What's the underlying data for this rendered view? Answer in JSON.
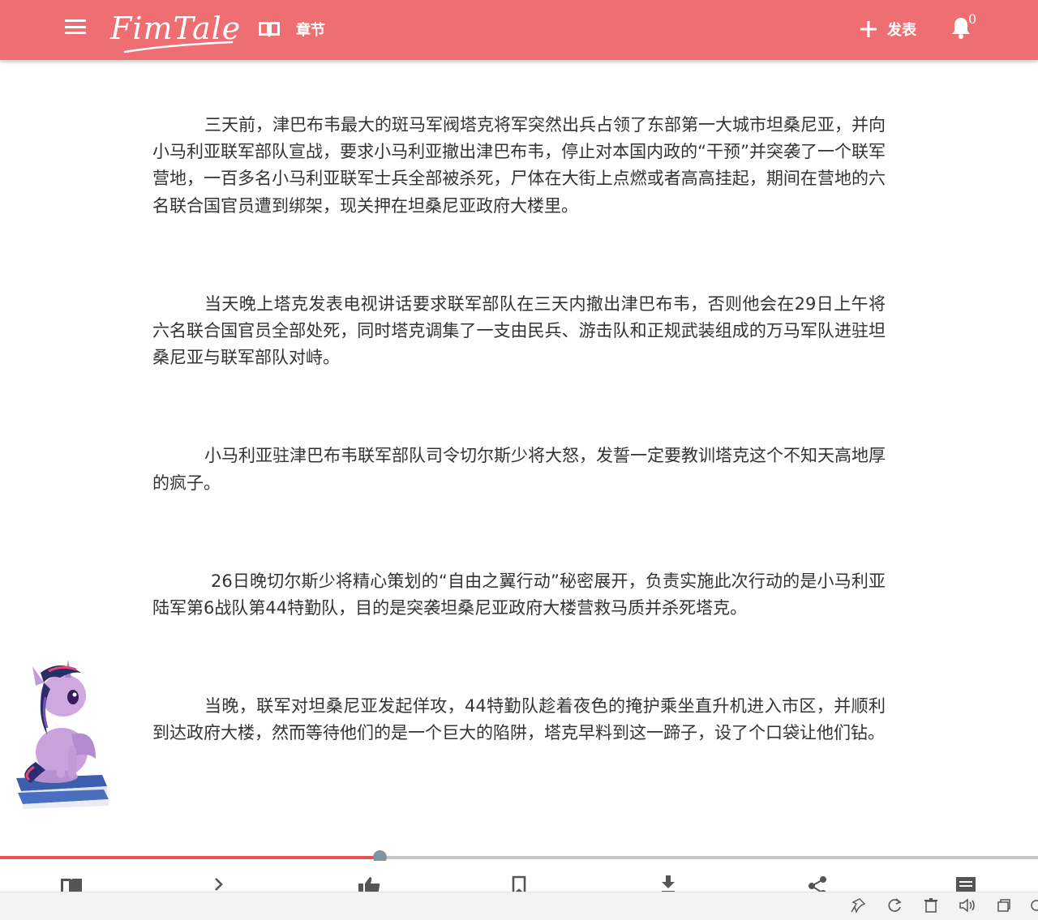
{
  "app": {
    "logo_text": "FimTale",
    "chapters_label": "章节",
    "publish_label": "发表",
    "notification_count": "0"
  },
  "article": {
    "paragraphs": [
      "三天前，津巴布韦最大的斑马军阀塔克将军突然出兵占领了东部第一大城市坦桑尼亚，并向小马利亚联军部队宣战，要求小马利亚撤出津巴布韦，停止对本国内政的“干预”并突袭了一个联军营地，一百多名小马利亚联军士兵全部被杀死，尸体在大街上点燃或者高高挂起，期间在营地的六名联合国官员遭到绑架，现关押在坦桑尼亚政府大楼里。",
      "当天晚上塔克发表电视讲话要求联军部队在三天内撤出津巴布韦，否则他会在29日上午将六名联合国官员全部处死，同时塔克调集了一支由民兵、游击队和正规武装组成的万马军队进驻坦桑尼亚与联军部队对峙。",
      "小马利亚驻津巴布韦联军部队司令切尔斯少将大怒，发誓一定要教训塔克这个不知天高地厚的疯子。",
      "26日晚切尔斯少将精心策划的“自由之翼行动”秘密展开，负责实施此次行动的是小马利亚陆军第6战队第44特勤队，目的是突袭坦桑尼亚政府大楼营救马质并杀死塔克。",
      "当晚，联军对坦桑尼亚发起佯攻，44特勤队趁着夜色的掩护乘坐直升机进入市区，并顺利到达政府大楼，然而等待他们的是一个巨大的陷阱，塔克早料到这一蹄子，设了个口袋让他们钻。"
    ]
  },
  "reading_progress": 0.366,
  "colors": {
    "header": "#ef6e72",
    "progress_fill": "#e8524f",
    "progress_thumb": "#7f95a3",
    "progress_track": "#c7c7c7"
  },
  "toolbar_icons": [
    "book-icon",
    "chevron-right-icon",
    "thumbs-up-icon",
    "bookmark-icon",
    "download-icon",
    "share-icon",
    "comment-icon"
  ],
  "system_icons": [
    "pin-icon",
    "refresh-icon",
    "trash-icon",
    "speaker-icon",
    "window-icon"
  ]
}
